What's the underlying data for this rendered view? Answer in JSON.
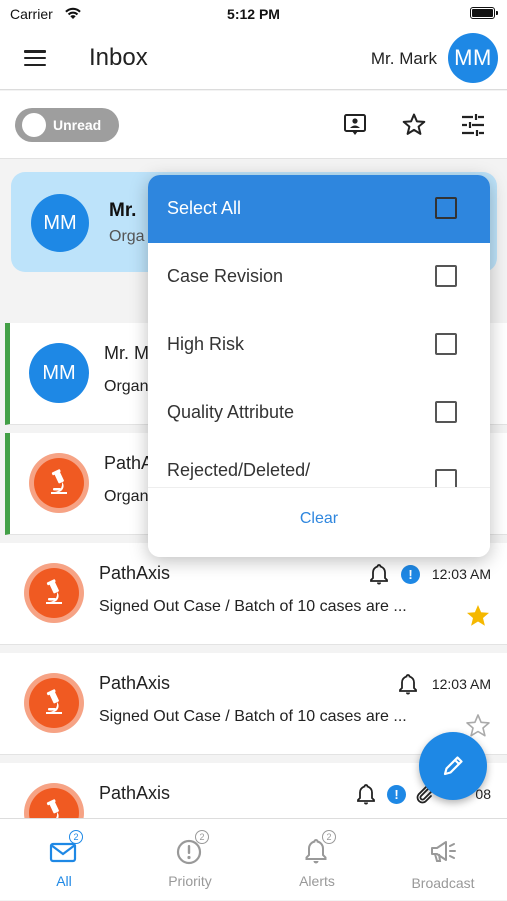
{
  "status_bar": {
    "carrier": "Carrier",
    "time": "5:12 PM"
  },
  "header": {
    "title": "Inbox",
    "user_name": "Mr. Mark",
    "avatar_initials": "MM"
  },
  "toolbar": {
    "toggle_label": "Unread",
    "icons": [
      "contact-card-icon",
      "star-outline-icon",
      "filter-sliders-icon"
    ]
  },
  "top_card": {
    "initials": "MM",
    "name": "Mr.",
    "subtitle": "Orga"
  },
  "messages": [
    {
      "initials": "MM",
      "sender": "Mr. M",
      "body": "Organ",
      "time": "",
      "unread": true,
      "avatar": "initials",
      "right_mark": "|"
    },
    {
      "sender": "PathA",
      "body": "Organ",
      "time": "",
      "unread": true,
      "avatar": "lab-icon",
      "right_mark": "|"
    },
    {
      "sender": "PathAxis",
      "body": "Signed Out Case / Batch of 10 cases are ...",
      "time": "12:03 AM",
      "unread": false,
      "avatar": "lab-icon",
      "bell": true,
      "alert": true,
      "alert_glyph": "!",
      "starred": true
    },
    {
      "sender": "PathAxis",
      "body": "Signed Out Case / Batch of 10 cases are ...",
      "time": "12:03 AM",
      "unread": false,
      "avatar": "lab-icon",
      "bell": true,
      "alert": false,
      "starred": false
    },
    {
      "sender": "PathAxis",
      "body": "",
      "time": "08",
      "unread": false,
      "avatar": "lab-icon",
      "bell": true,
      "alert": true,
      "alert_glyph": "!",
      "attachment": true
    }
  ],
  "filter_menu": {
    "items": [
      {
        "label": "Select All",
        "selected": true
      },
      {
        "label": "Case Revision",
        "selected": false
      },
      {
        "label": "High Risk",
        "selected": false
      },
      {
        "label": "Quality Attribute",
        "selected": false
      },
      {
        "label": "Rejected/Deleted/",
        "selected": false
      }
    ],
    "clear_label": "Clear"
  },
  "tabs": [
    {
      "label": "All",
      "badge": "2",
      "active": true,
      "icon": "mail-icon"
    },
    {
      "label": "Priority",
      "badge": "2",
      "active": false,
      "icon": "priority-icon"
    },
    {
      "label": "Alerts",
      "badge": "2",
      "active": false,
      "icon": "bell-icon"
    },
    {
      "label": "Broadcast",
      "badge": "",
      "active": false,
      "icon": "megaphone-icon"
    }
  ],
  "colors": {
    "primary": "#1e88e5",
    "unread_bar": "#43a047",
    "lab_orange": "#f05a22",
    "star_gold": "#f5b800",
    "card_highlight": "#bde3fa"
  }
}
